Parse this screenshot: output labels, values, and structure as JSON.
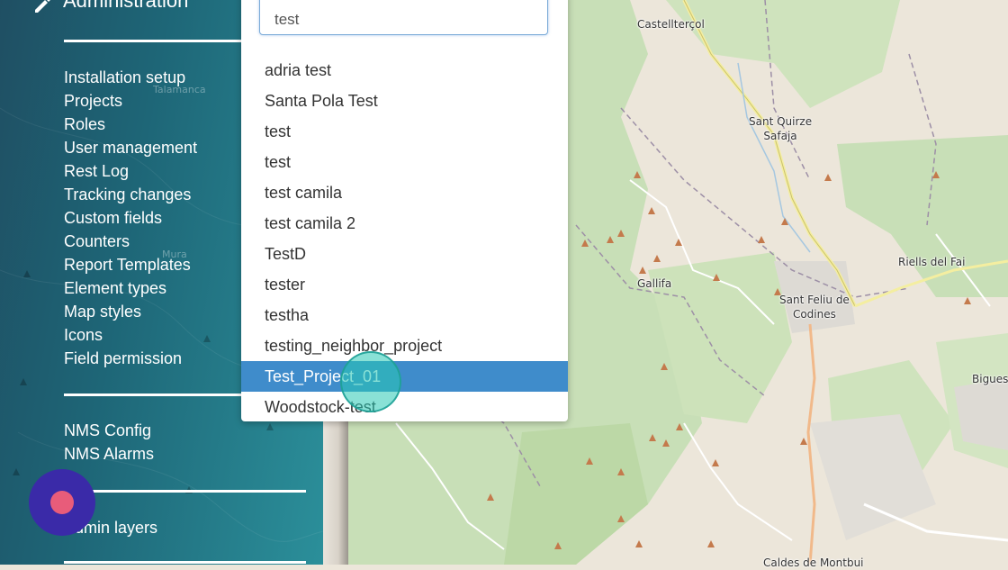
{
  "sidebar": {
    "title": "Administration",
    "menu_group_1": [
      "Installation setup",
      "Projects",
      "Roles",
      "User management",
      "Rest Log",
      "Tracking changes",
      "Custom fields",
      "Counters",
      "Report Templates",
      "Element types",
      "Map styles",
      "Icons",
      "Field permission"
    ],
    "menu_group_2": [
      "NMS Config",
      "NMS Alarms"
    ],
    "menu_group_3": [
      "Admin layers"
    ],
    "faint_labels": [
      "Talamanca",
      "Mura"
    ]
  },
  "dropdown": {
    "search_value": "test",
    "options": [
      "adria test",
      "Santa Pola Test",
      "test",
      "test",
      "test camila",
      "test camila 2",
      "TestD",
      "tester",
      "testha",
      "testing_neighbor_project",
      "Test_Project_01",
      "Woodstock-test"
    ],
    "selected_option": "Test_Project_01"
  },
  "map": {
    "places": [
      "Castellterçol",
      "Sant Quirze\nSafaja",
      "Riells del Fai",
      "Gallifa",
      "Sant Feliu de\nCodines",
      "Bigues",
      "Caldes de Montbui"
    ]
  },
  "colors": {
    "sidebar_accent": "#2b8f9a",
    "selected_option": "#3f8ccb",
    "fab": "#3a2aa8",
    "fab_dot": "#e85c7a",
    "forest": "#c8dfb7",
    "land": "#ece6da"
  }
}
